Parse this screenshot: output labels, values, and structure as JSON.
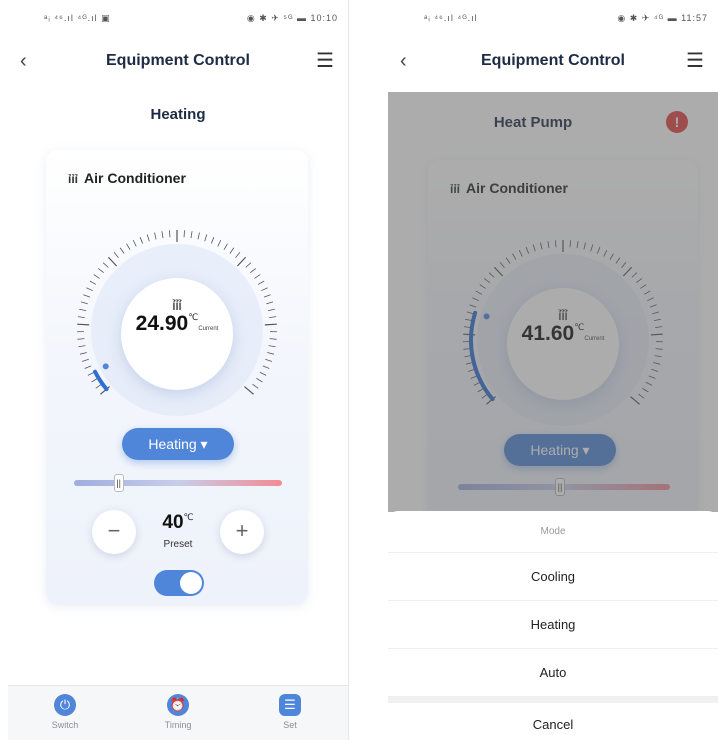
{
  "left": {
    "status": {
      "left": "ᵃᵢ ⁴⁶.ıl ⁴ᴳ.ıl ▣",
      "right": "◉ ✱ ✈ ⁵ᴳ ▬ 10:10"
    },
    "nav": {
      "back": "‹",
      "title": "Equipment Control",
      "menu": "☰"
    },
    "mode_title": "Heating",
    "card": {
      "device_icon": "ỉỉỉ",
      "device": "Air Conditioner",
      "dial_icon": "ỉỉỉ",
      "temp": "24.90",
      "unit": "℃",
      "current_label": "Current",
      "dial_level_fraction": 0.05
    },
    "mode_button": "Heating ▾",
    "slider_knob": "||",
    "slider_fraction": 0.2,
    "minus": "−",
    "plus": "+",
    "preset_value": "40",
    "preset_unit": "℃",
    "preset_label": "Preset",
    "toggle_on": true,
    "tabs": [
      {
        "label": "Switch",
        "icon": "⏻"
      },
      {
        "label": "Timing",
        "icon": "⏰"
      },
      {
        "label": "Set",
        "icon": "☰"
      }
    ]
  },
  "right": {
    "status": {
      "left": "ᵃᵢ ⁴⁶.ıl ⁴ᴳ.ıl",
      "right": "◉ ✱ ✈ ⁴ᴳ ▬ 11:57"
    },
    "nav": {
      "back": "‹",
      "title": "Equipment Control",
      "menu": "☰"
    },
    "mode_title": "Heat Pump",
    "alert": "!",
    "card": {
      "device_icon": "ỉỉỉ",
      "device": "Air Conditioner",
      "dial_icon": "ỉỉỉ",
      "temp": "41.60",
      "unit": "℃",
      "current_label": "Current",
      "dial_level_fraction": 0.22
    },
    "mode_button": "Heating ▾",
    "slider_knob": "||",
    "slider_fraction": 0.48,
    "sheet": {
      "header": "Mode",
      "options": [
        "Cooling",
        "Heating",
        "Auto"
      ],
      "cancel": "Cancel"
    }
  }
}
